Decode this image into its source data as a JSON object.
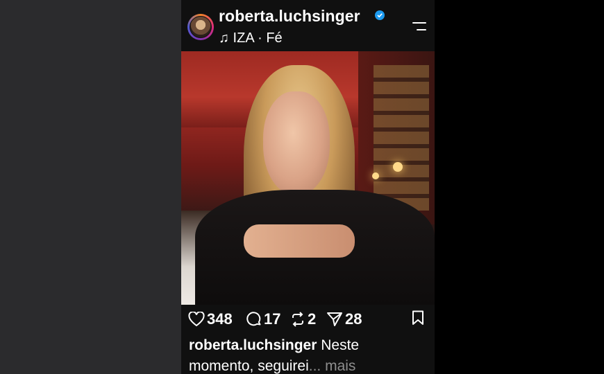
{
  "post": {
    "username": "roberta.luchsinger",
    "music": "♫ IZA · Fé",
    "counts": {
      "likes": "348",
      "comments": "17",
      "reposts": "2",
      "shares": "28"
    },
    "caption_user": "roberta.luchsinger",
    "caption_text_line1": " Neste",
    "caption_text_line2": "momento, seguirei",
    "caption_more": "... mais"
  },
  "colors": {
    "verified": "#1d9bf0",
    "background": "#101010"
  },
  "icons": [
    "heart-icon",
    "comment-icon",
    "repost-icon",
    "share-icon",
    "bookmark-icon",
    "menu-icon",
    "mute-icon",
    "verified-icon"
  ]
}
